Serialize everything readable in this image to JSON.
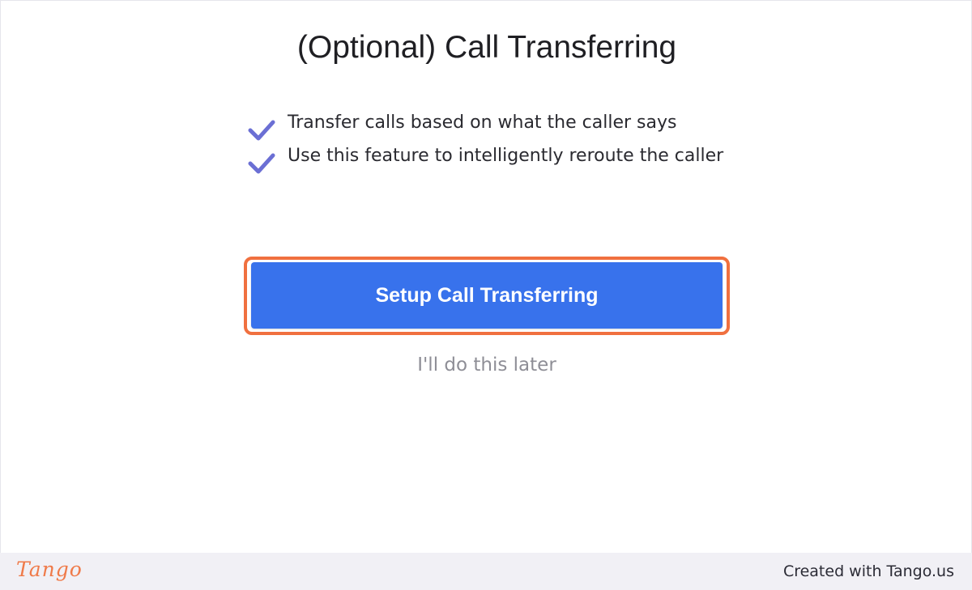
{
  "dialog": {
    "title": "(Optional) Call Transferring",
    "features": [
      {
        "text": "Transfer calls based on what the caller says",
        "icon": "checkmark-icon"
      },
      {
        "text": "Use this feature to intelligently reroute the caller",
        "icon": "checkmark-icon"
      }
    ],
    "primary_button_label": "Setup Call Transferring",
    "secondary_link_label": "I'll do this later"
  },
  "footer": {
    "logo_text": "Tango",
    "credit_text": "Created with Tango.us"
  },
  "colors": {
    "accent": "#3872ec",
    "highlight": "#f0703f",
    "check": "#6b6fd4",
    "muted_text": "#8e8e96"
  }
}
